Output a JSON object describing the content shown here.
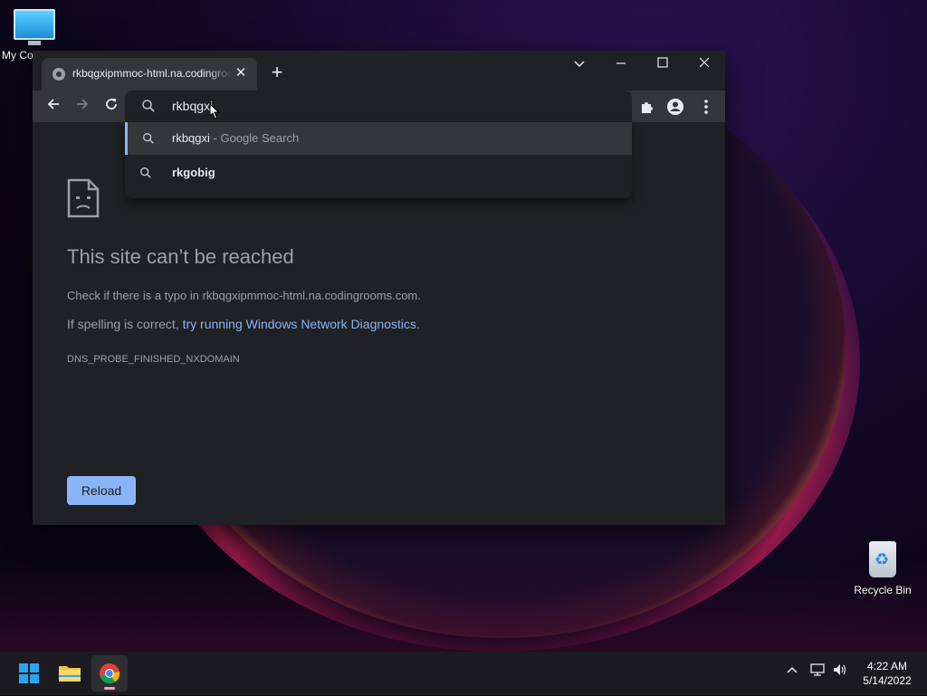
{
  "desktop": {
    "icons": [
      {
        "label": "My Co"
      },
      {
        "label": "Recycle Bin"
      }
    ]
  },
  "browser": {
    "tab": {
      "title": "rkbqgxipmmoc-html.na.codingrooms.com"
    },
    "omnibox": {
      "value": "rkbqgxi"
    },
    "suggestions": [
      {
        "text": "rkbqgxi",
        "suffix": " - Google Search"
      },
      {
        "text": "rkgobig",
        "suffix": ""
      }
    ],
    "error": {
      "title": "This site can’t be reached",
      "check_text": "Check if there is a typo in rkbqgxipmmoc-html.na.codingrooms.com.",
      "spelling_prefix": "If spelling is correct, ",
      "spelling_link": "try running Windows Network Diagnostics",
      "spelling_suffix": ".",
      "code": "DNS_PROBE_FINISHED_NXDOMAIN",
      "reload_label": "Reload"
    }
  },
  "taskbar": {
    "apps": [
      "start-icon",
      "file-explorer-icon",
      "chrome-icon"
    ],
    "clock": {
      "time": "4:22 AM",
      "date": "5/14/2022"
    }
  },
  "colors": {
    "accent": "#8ab4f8",
    "bg": "#202124",
    "toolbar": "#35363a"
  }
}
